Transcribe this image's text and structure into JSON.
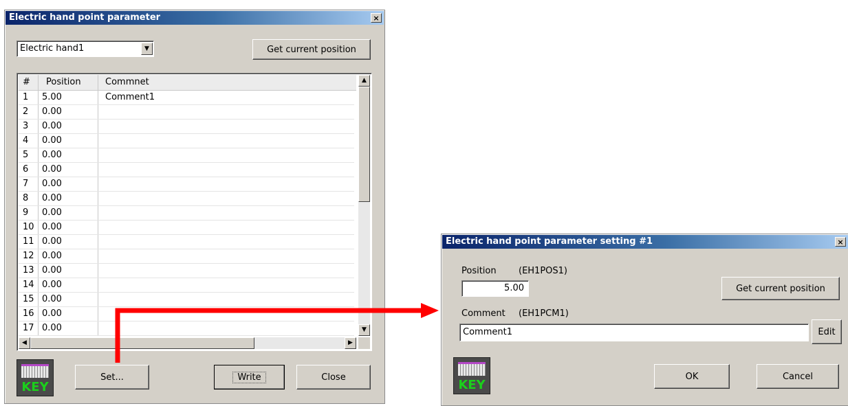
{
  "left_dialog": {
    "title": "Electric hand point parameter",
    "close_glyph": "×",
    "hand_select_value": "Electric hand1",
    "get_position_label": "Get current position",
    "grid": {
      "headers": [
        "#",
        "Position",
        "Commnet"
      ],
      "rows": [
        {
          "num": "1",
          "position": "5.00",
          "comment": "Comment1"
        },
        {
          "num": "2",
          "position": "0.00",
          "comment": ""
        },
        {
          "num": "3",
          "position": "0.00",
          "comment": ""
        },
        {
          "num": "4",
          "position": "0.00",
          "comment": ""
        },
        {
          "num": "5",
          "position": "0.00",
          "comment": ""
        },
        {
          "num": "6",
          "position": "0.00",
          "comment": ""
        },
        {
          "num": "7",
          "position": "0.00",
          "comment": ""
        },
        {
          "num": "8",
          "position": "0.00",
          "comment": ""
        },
        {
          "num": "9",
          "position": "0.00",
          "comment": ""
        },
        {
          "num": "10",
          "position": "0.00",
          "comment": ""
        },
        {
          "num": "11",
          "position": "0.00",
          "comment": ""
        },
        {
          "num": "12",
          "position": "0.00",
          "comment": ""
        },
        {
          "num": "13",
          "position": "0.00",
          "comment": ""
        },
        {
          "num": "14",
          "position": "0.00",
          "comment": ""
        },
        {
          "num": "15",
          "position": "0.00",
          "comment": ""
        },
        {
          "num": "16",
          "position": "0.00",
          "comment": ""
        },
        {
          "num": "17",
          "position": "0.00",
          "comment": ""
        }
      ]
    },
    "key_label": "KEY",
    "set_label": "Set...",
    "write_label": "Write",
    "close_label": "Close"
  },
  "right_dialog": {
    "title": "Electric hand point parameter setting #1",
    "close_glyph": "×",
    "position_label": "Position",
    "position_var": "(EH1POS1)",
    "position_value": "5.00",
    "get_position_label": "Get current position",
    "comment_label": "Comment",
    "comment_var": "(EH1PCM1)",
    "comment_value": "Comment1",
    "edit_label": "Edit",
    "key_label": "KEY",
    "ok_label": "OK",
    "cancel_label": "Cancel"
  },
  "annotation": {
    "arrow_color": "#ff0000"
  }
}
